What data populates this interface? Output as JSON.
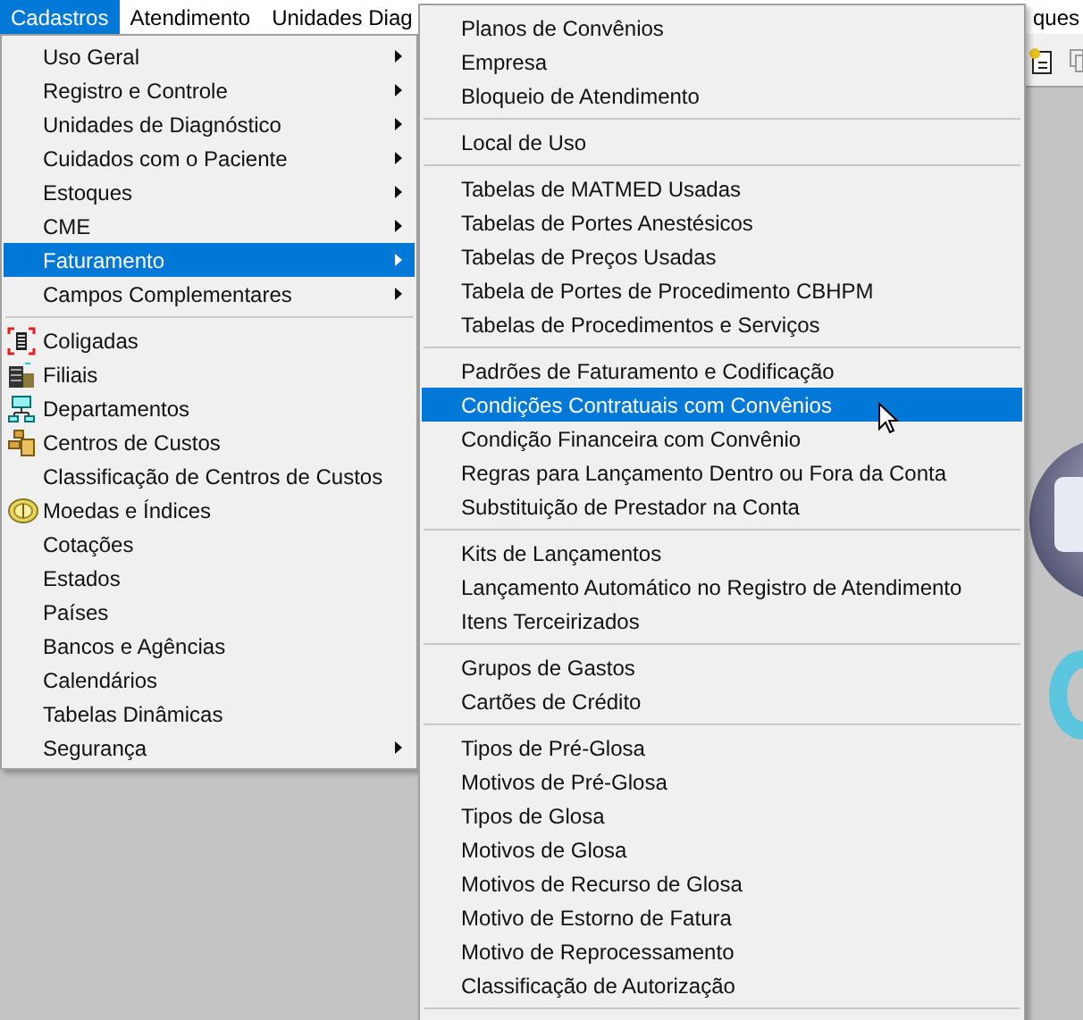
{
  "menubar": [
    {
      "label": "Cadastros",
      "selected": true
    },
    {
      "label": "Atendimento",
      "selected": false
    },
    {
      "label": "Unidades Diag",
      "selected": false
    },
    {
      "label": "ques",
      "selected": false
    }
  ],
  "menu": [
    {
      "kind": "item",
      "label": "Uso Geral",
      "submenu": true,
      "selected": false
    },
    {
      "kind": "item",
      "label": "Registro e Controle",
      "submenu": true,
      "selected": false
    },
    {
      "kind": "item",
      "label": "Unidades de Diagnóstico",
      "submenu": true,
      "selected": false
    },
    {
      "kind": "item",
      "label": "Cuidados com o Paciente",
      "submenu": true,
      "selected": false
    },
    {
      "kind": "item",
      "label": "Estoques",
      "submenu": true,
      "selected": false
    },
    {
      "kind": "item",
      "label": "CME",
      "submenu": true,
      "selected": false
    },
    {
      "kind": "item",
      "label": "Faturamento",
      "submenu": true,
      "selected": true
    },
    {
      "kind": "item",
      "label": "Campos Complementares",
      "submenu": true,
      "selected": false
    },
    {
      "kind": "separator"
    },
    {
      "kind": "item",
      "label": "Coligadas",
      "submenu": false,
      "selected": false
    },
    {
      "kind": "item",
      "label": "Filiais",
      "submenu": false,
      "selected": false
    },
    {
      "kind": "item",
      "label": "Departamentos",
      "submenu": false,
      "selected": false
    },
    {
      "kind": "item",
      "label": "Centros de Custos",
      "submenu": false,
      "selected": false
    },
    {
      "kind": "item",
      "label": "Classificação de Centros de Custos",
      "submenu": false,
      "selected": false
    },
    {
      "kind": "item",
      "label": "Moedas e Índices",
      "submenu": false,
      "selected": false
    },
    {
      "kind": "item",
      "label": "Cotações",
      "submenu": false,
      "selected": false
    },
    {
      "kind": "item",
      "label": "Estados",
      "submenu": false,
      "selected": false
    },
    {
      "kind": "item",
      "label": "Países",
      "submenu": false,
      "selected": false
    },
    {
      "kind": "item",
      "label": "Bancos e Agências",
      "submenu": false,
      "selected": false
    },
    {
      "kind": "item",
      "label": "Calendários",
      "submenu": false,
      "selected": false
    },
    {
      "kind": "item",
      "label": "Tabelas Dinâmicas",
      "submenu": false,
      "selected": false
    },
    {
      "kind": "item",
      "label": "Segurança",
      "submenu": true,
      "selected": false
    }
  ],
  "submenu": [
    {
      "kind": "item",
      "label": "Planos de Convênios",
      "selected": false
    },
    {
      "kind": "item",
      "label": "Empresa",
      "selected": false
    },
    {
      "kind": "item",
      "label": "Bloqueio de Atendimento",
      "selected": false
    },
    {
      "kind": "separator"
    },
    {
      "kind": "item",
      "label": "Local de Uso",
      "selected": false
    },
    {
      "kind": "separator"
    },
    {
      "kind": "item",
      "label": "Tabelas de MATMED Usadas",
      "selected": false
    },
    {
      "kind": "item",
      "label": "Tabelas de Portes Anestésicos",
      "selected": false
    },
    {
      "kind": "item",
      "label": "Tabelas de Preços Usadas",
      "selected": false
    },
    {
      "kind": "item",
      "label": "Tabela de Portes de Procedimento CBHPM",
      "selected": false
    },
    {
      "kind": "item",
      "label": "Tabelas de Procedimentos e Serviços",
      "selected": false
    },
    {
      "kind": "separator"
    },
    {
      "kind": "item",
      "label": "Padrões de Faturamento e Codificação",
      "selected": false
    },
    {
      "kind": "item",
      "label": "Condições Contratuais com Convênios",
      "selected": true
    },
    {
      "kind": "item",
      "label": "Condição Financeira com Convênio",
      "selected": false
    },
    {
      "kind": "item",
      "label": "Regras para Lançamento Dentro ou Fora da Conta",
      "selected": false
    },
    {
      "kind": "item",
      "label": "Substituição de Prestador na Conta",
      "selected": false
    },
    {
      "kind": "separator"
    },
    {
      "kind": "item",
      "label": "Kits de Lançamentos",
      "selected": false
    },
    {
      "kind": "item",
      "label": "Lançamento Automático no Registro de Atendimento",
      "selected": false
    },
    {
      "kind": "item",
      "label": "Itens Terceirizados",
      "selected": false
    },
    {
      "kind": "separator"
    },
    {
      "kind": "item",
      "label": "Grupos de Gastos",
      "selected": false
    },
    {
      "kind": "item",
      "label": "Cartões de Crédito",
      "selected": false
    },
    {
      "kind": "separator"
    },
    {
      "kind": "item",
      "label": "Tipos de Pré-Glosa",
      "selected": false
    },
    {
      "kind": "item",
      "label": "Motivos de Pré-Glosa",
      "selected": false
    },
    {
      "kind": "item",
      "label": "Tipos de Glosa",
      "selected": false
    },
    {
      "kind": "item",
      "label": "Motivos de Glosa",
      "selected": false
    },
    {
      "kind": "item",
      "label": "Motivos de Recurso de Glosa",
      "selected": false
    },
    {
      "kind": "item",
      "label": "Motivo de Estorno de Fatura",
      "selected": false
    },
    {
      "kind": "item",
      "label": "Motivo de Reprocessamento",
      "selected": false
    },
    {
      "kind": "item",
      "label": "Classificação de Autorização",
      "selected": false
    },
    {
      "kind": "separator"
    }
  ]
}
